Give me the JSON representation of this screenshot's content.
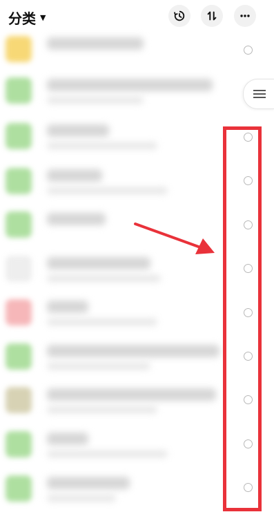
{
  "header": {
    "title": "分类",
    "title_caret": "▼",
    "buttons": [
      {
        "name": "history-button",
        "icon": "history-icon"
      },
      {
        "name": "sort-button",
        "icon": "sort-icon"
      },
      {
        "name": "more-button",
        "icon": "more-icon"
      }
    ]
  },
  "list": {
    "rows": [
      {
        "thumb_color": "#f7d876",
        "line1_w": 140,
        "line2_w": 0
      },
      {
        "thumb_color": "#aedfa0",
        "line1_w": 240,
        "line2_w": 140
      },
      {
        "thumb_color": "#aedfa0",
        "line1_w": 90,
        "line2_w": 160
      },
      {
        "thumb_color": "#aedfa0",
        "line1_w": 80,
        "line2_w": 175
      },
      {
        "thumb_color": "#aedfa0",
        "line1_w": 85,
        "line2_w": 0
      },
      {
        "thumb_color": "#eeeeee",
        "line1_w": 150,
        "line2_w": 165
      },
      {
        "thumb_color": "#f6b7b9",
        "line1_w": 60,
        "line2_w": 160
      },
      {
        "thumb_color": "#aedfa0",
        "line1_w": 250,
        "line2_w": 150
      },
      {
        "thumb_color": "#d7d2b4",
        "line1_w": 245,
        "line2_w": 160
      },
      {
        "thumb_color": "#aedfa0",
        "line1_w": 60,
        "line2_w": 175
      },
      {
        "thumb_color": "#aedfa0",
        "line1_w": 120,
        "line2_w": 100
      }
    ]
  },
  "overlay": {
    "highlight_color": "#e9323a",
    "arrow_color": "#e9323a"
  }
}
